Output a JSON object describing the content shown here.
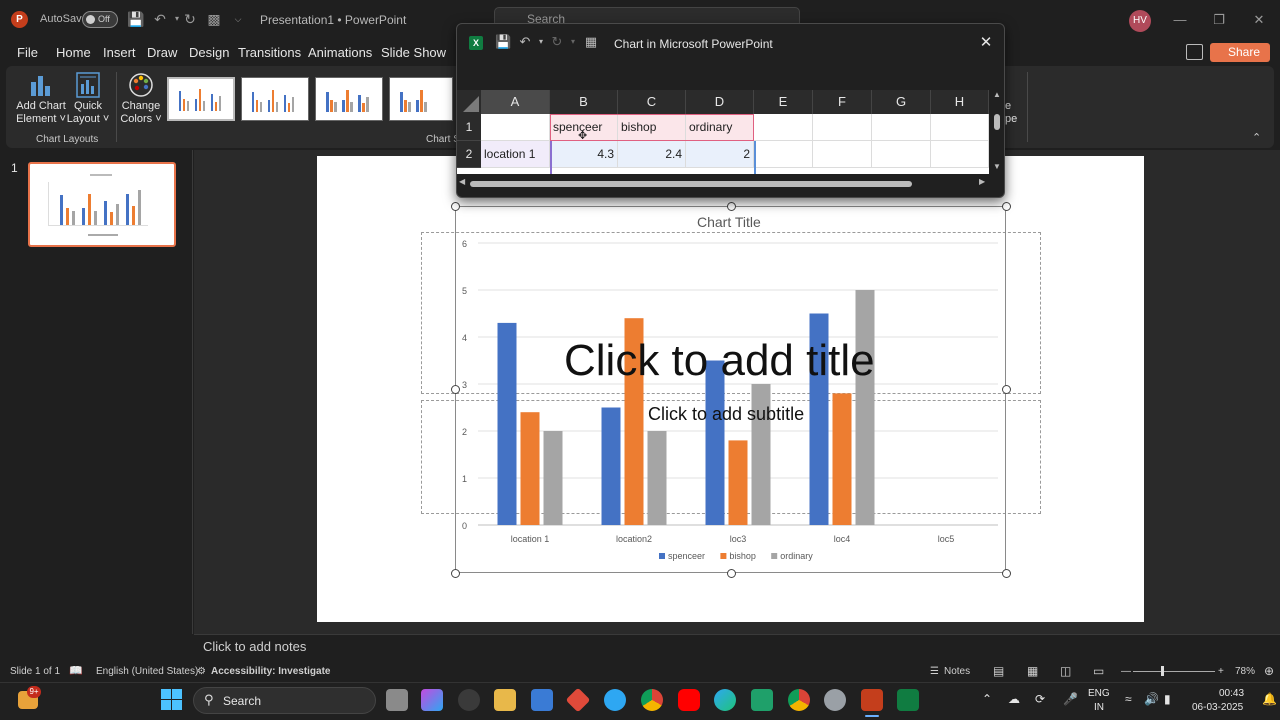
{
  "titlebar": {
    "app_letter": "P",
    "autosave_label": "AutoSave",
    "autosave_state": "Off",
    "doc_title": "Presentation1 • PowerPoint",
    "search_placeholder": "Search",
    "user_initials": "HV"
  },
  "menu": {
    "file": "File",
    "home": "Home",
    "insert": "Insert",
    "draw": "Draw",
    "design": "Design",
    "transitions": "Transitions",
    "animations": "Animations",
    "slide_show": "Slide Show",
    "share": "Share"
  },
  "ribbon": {
    "add_chart_element_1": "Add Chart",
    "add_chart_element_2": "Element",
    "quick_layout_1": "Quick",
    "quick_layout_2": "Layout",
    "change_colors_1": "Change",
    "change_colors_2": "Colors",
    "group_chart_layouts": "Chart Layouts",
    "group_chart_styles": "Chart S",
    "right_partial_1": "e",
    "right_partial_2": "pe"
  },
  "slides_pane": {
    "slide_number": "1"
  },
  "slide": {
    "title_placeholder": "Click to add title",
    "subtitle_placeholder": "Click to add subtitle"
  },
  "chart_data": {
    "type": "bar",
    "title": "Chart Title",
    "categories": [
      "location  1",
      "location2",
      "loc3",
      "loc4",
      "loc5"
    ],
    "series": [
      {
        "name": "spenceer",
        "color": "#4472c4",
        "values": [
          4.3,
          2.5,
          3.5,
          4.5,
          null
        ]
      },
      {
        "name": "bishop",
        "color": "#ed7d31",
        "values": [
          2.4,
          4.4,
          1.8,
          2.8,
          null
        ]
      },
      {
        "name": "ordinary",
        "color": "#a5a5a5",
        "values": [
          2,
          2,
          3,
          5,
          null
        ]
      }
    ],
    "ylim": [
      0,
      6
    ],
    "yticks": [
      "0",
      "1",
      "2",
      "3",
      "4",
      "5",
      "6"
    ],
    "grid": true,
    "legend": "bottom"
  },
  "excel": {
    "window_title": "Chart in Microsoft PowerPoint",
    "columns": [
      "A",
      "B",
      "C",
      "D",
      "E",
      "F",
      "G",
      "H"
    ],
    "rows": [
      "1",
      "2"
    ],
    "row1": [
      "",
      "spenceer",
      "bishop",
      "ordinary",
      "",
      "",
      "",
      ""
    ],
    "row2": [
      "location  1",
      "4.3",
      "2.4",
      "2",
      "",
      "",
      "",
      ""
    ]
  },
  "notes": {
    "placeholder": "Click to add notes"
  },
  "status": {
    "slide_count": "Slide 1 of 1",
    "language": "English (United States)",
    "accessibility": "Accessibility: Investigate",
    "notes_btn": "Notes",
    "zoom": "78%"
  },
  "taskbar": {
    "badge": "9+",
    "search": "Search",
    "lang_1": "ENG",
    "lang_2": "IN",
    "time": "00:43",
    "date": "06-03-2025"
  }
}
